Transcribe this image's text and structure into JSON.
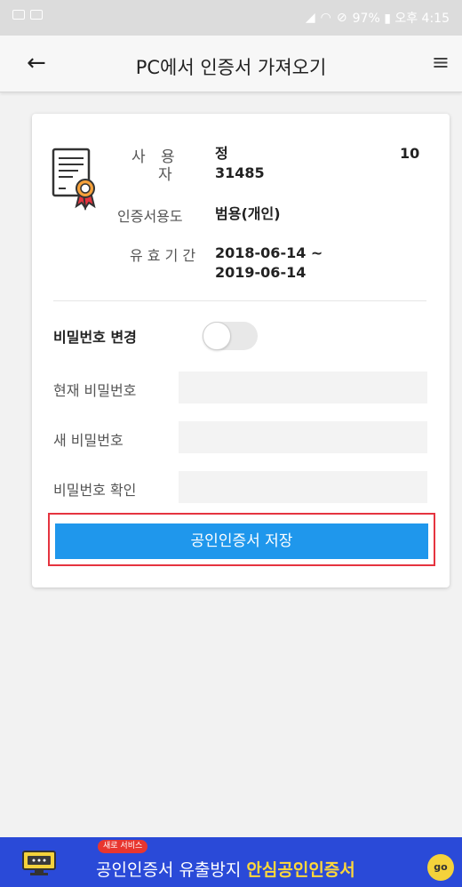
{
  "statusbar": {
    "right_text": "97% ▮ 오후 4:15"
  },
  "appbar": {
    "title": "PC에서 인증서 가져오기",
    "back_glyph": "←",
    "menu_glyph": "≡"
  },
  "cert": {
    "user_label_top": "사 용",
    "user_label_bottom": "자",
    "user_name": "정",
    "user_suffix": "10",
    "user_id": "31485",
    "purpose_label": "인증서용도",
    "purpose_value": "범용(개인)",
    "validity_label": "유 효 기 간",
    "validity_start": "2018-06-14 ~",
    "validity_end": "2019-06-14"
  },
  "password": {
    "change_label": "비밀번호 변경",
    "change_enabled": false,
    "current_label": "현재 비밀번호",
    "current_value": "",
    "new_label": "새 비밀번호",
    "new_value": "",
    "confirm_label": "비밀번호 확인",
    "confirm_value": ""
  },
  "save_button": "공인인증서 저장",
  "banner": {
    "badge": "새로 서비스",
    "text_plain": "공인인증서 유출방지 ",
    "text_highlight": "안심공인인증서",
    "go": "go"
  },
  "colors": {
    "accent": "#1f97ec",
    "highlight_border": "#e5343f",
    "banner_bg": "#2a4ad8",
    "banner_highlight": "#ffd83a"
  }
}
